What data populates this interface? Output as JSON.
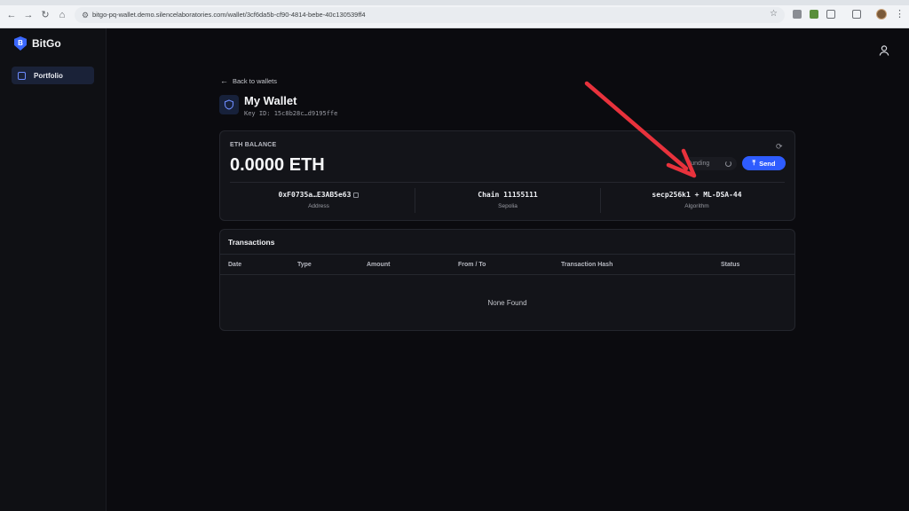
{
  "browser": {
    "url": "bitgo-pq-wallet.demo.silencelaboratories.com/wallet/3cf6da5b-cf90-4814-bebe-40c130539ff4"
  },
  "sidebar": {
    "brand": "BitGo",
    "brand_logo_letter": "B",
    "items": [
      {
        "label": "Portfolio",
        "icon": "portfolio-icon",
        "active": true
      }
    ]
  },
  "main": {
    "back_link": "Back to wallets",
    "wallet": {
      "name": "My Wallet",
      "key_id": "Key ID: 15c8b28c…d9195ffe"
    },
    "balance": {
      "label": "ETH BALANCE",
      "value": "0.0000 ETH",
      "funding_label": "Funding",
      "send_label": "Send"
    },
    "details": [
      {
        "value": "0xF0735a…E3AB5e63",
        "label": "Address"
      },
      {
        "value": "Chain 11155111",
        "label": "Sepolia"
      },
      {
        "value": "secp256k1 + ML-DSA-44",
        "label": "Algorithm"
      }
    ],
    "transactions": {
      "title": "Transactions",
      "columns": [
        "Date",
        "Type",
        "Amount",
        "From / To",
        "Transaction Hash",
        "Status"
      ],
      "empty_text": "None Found"
    }
  },
  "colors": {
    "accent": "#2e5cff",
    "background": "#0b0b0f",
    "card": "#131419",
    "annotation_arrow": "#e8323c"
  }
}
